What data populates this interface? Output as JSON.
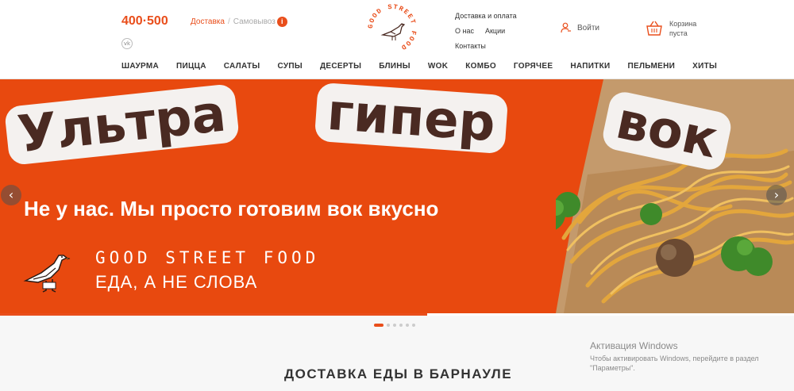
{
  "header": {
    "phone": "400·500",
    "vk_label": "vk",
    "delivery_active": "Доставка",
    "delivery_separator": "/",
    "delivery_inactive": "Самовывоз",
    "info_label": "i",
    "logo_text": "GOOD STREET FOOD",
    "links_row1": [
      "Доставка и оплата"
    ],
    "links_row2": [
      "О нас",
      "Акции"
    ],
    "links_row3": [
      "Контакты"
    ],
    "login_label": "Войти",
    "cart_label": "Корзина",
    "cart_status": "пуста"
  },
  "menu": [
    "ШАУРМА",
    "ПИЦЦА",
    "САЛАТЫ",
    "СУПЫ",
    "ДЕСЕРТЫ",
    "БЛИНЫ",
    "WOK",
    "КОМБО",
    "ГОРЯЧЕЕ",
    "НАПИТКИ",
    "ПЕЛЬМЕНИ",
    "ХИТЫ"
  ],
  "banner": {
    "headline_1": "Ультра",
    "headline_2": "гипер",
    "headline_3": "вок",
    "subline": "Не у нас. Мы просто готовим вок вкусно",
    "brand_name": "GOOD STREET FOOD",
    "brand_tagline": "ЕДА, А НЕ СЛОВА",
    "prev_arrow": "‹",
    "next_arrow": "›",
    "slide_count": 6,
    "active_slide": 1
  },
  "section": {
    "title": "ДОСТАВКА ЕДЫ В БАРНАУЛЕ"
  },
  "os_overlay": {
    "title": "Активация Windows",
    "line1": "Чтобы активировать Windows, перейдите в раздел",
    "line2": "\"Параметры\"."
  },
  "colors": {
    "brand_orange": "#e94e1b",
    "banner_orange": "#e8490f",
    "headline_brown": "#4a2a22"
  }
}
